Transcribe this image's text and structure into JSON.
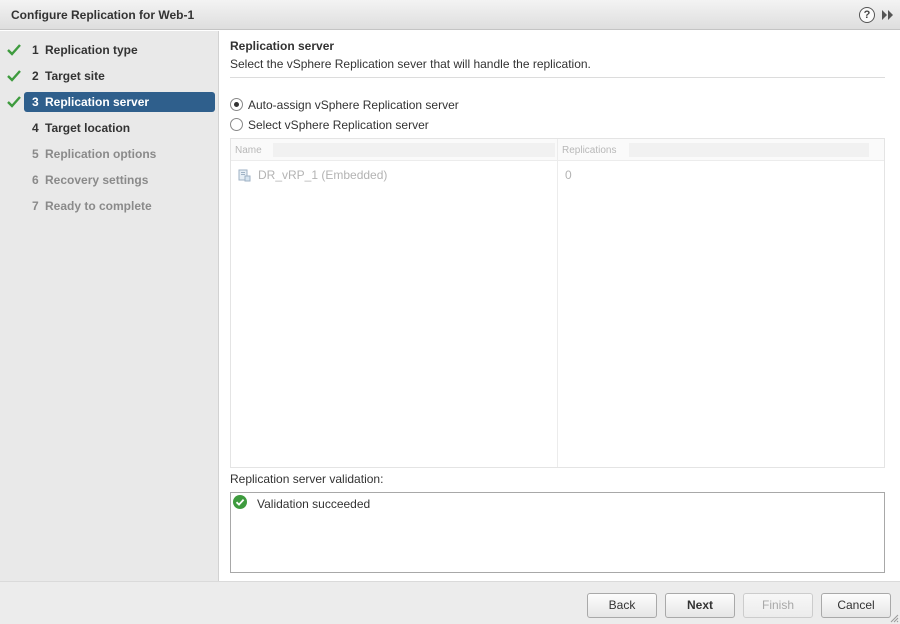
{
  "window": {
    "title": "Configure Replication for Web-1",
    "help_glyph": "?",
    "help_icon": "help-icon",
    "expand_icon": "double-chevron-right-icon"
  },
  "steps": [
    {
      "number": "1",
      "label": "Replication type",
      "state": "done"
    },
    {
      "number": "2",
      "label": "Target site",
      "state": "done"
    },
    {
      "number": "3",
      "label": "Replication server",
      "state": "active"
    },
    {
      "number": "4",
      "label": "Target location",
      "state": "current-next"
    },
    {
      "number": "5",
      "label": "Replication options",
      "state": "pending"
    },
    {
      "number": "6",
      "label": "Recovery settings",
      "state": "pending"
    },
    {
      "number": "7",
      "label": "Ready to complete",
      "state": "pending"
    }
  ],
  "main": {
    "title": "Replication server",
    "description": "Select the vSphere Replication sever that will handle the replication.",
    "options": [
      {
        "label": "Auto-assign vSphere Replication server",
        "selected": true
      },
      {
        "label": "Select vSphere Replication server",
        "selected": false
      }
    ],
    "table": {
      "columns": [
        "Name",
        "Replications"
      ],
      "rows": [
        {
          "name": "DR_vRP_1 (Embedded)",
          "replications": "0",
          "icon": "server-icon"
        }
      ]
    },
    "validation": {
      "label": "Replication server validation:",
      "message": "Validation succeeded",
      "icon": "success-check-icon"
    }
  },
  "footer": {
    "buttons": [
      {
        "label": "Back",
        "enabled": true
      },
      {
        "label": "Next",
        "enabled": true,
        "primary": true
      },
      {
        "label": "Finish",
        "enabled": false
      },
      {
        "label": "Cancel",
        "enabled": true
      }
    ]
  },
  "colors": {
    "active_step": "#2f5f8c",
    "check_green": "#3e9b3e",
    "sidebar_bg": "#e9e9e9",
    "disabled_text": "#a8a8a8"
  }
}
